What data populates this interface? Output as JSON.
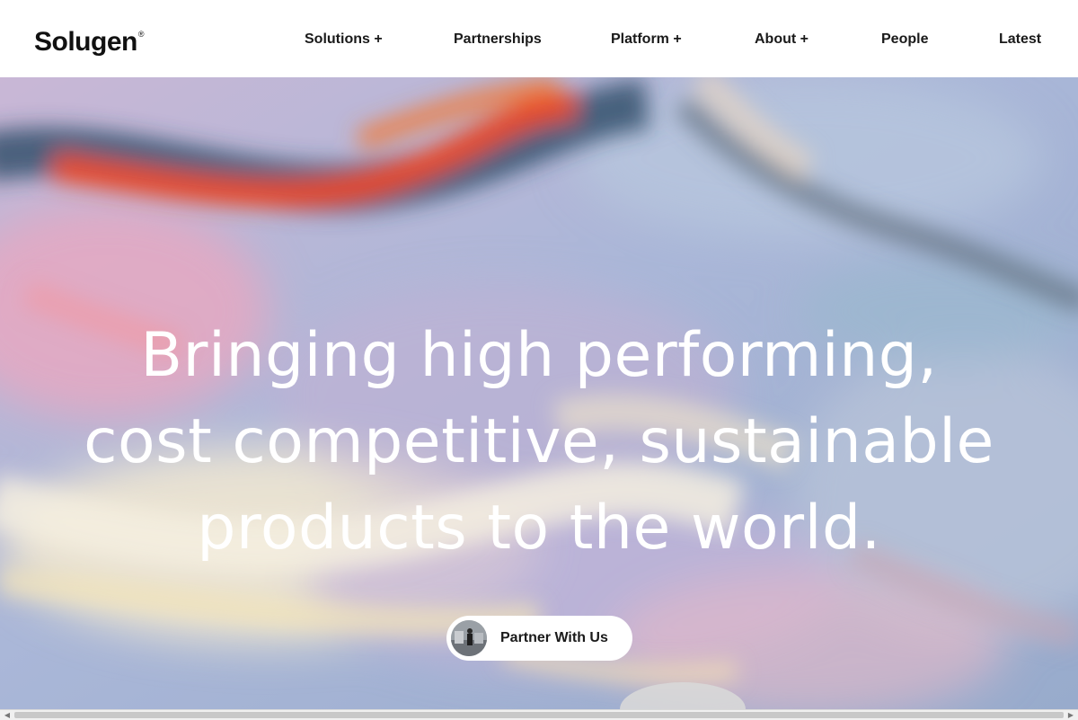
{
  "brand": {
    "name": "Solugen",
    "mark": "®"
  },
  "nav": {
    "items": [
      {
        "label": "Solutions +"
      },
      {
        "label": "Partnerships"
      },
      {
        "label": "Platform +"
      },
      {
        "label": "About +"
      },
      {
        "label": "People"
      },
      {
        "label": "Latest"
      }
    ]
  },
  "hero": {
    "headline_lines": [
      "Bringing high performing,",
      "cost competitive, sustainable",
      "products to the world."
    ],
    "cta_label": "Partner With Us"
  },
  "colors": {
    "header_bg": "#ffffff",
    "text": "#1a1a1a",
    "headline": "#ffffff",
    "cta_bg": "#ffffff"
  },
  "icons": {
    "scroll_left": "left-arrow-icon",
    "scroll_right": "right-arrow-icon"
  }
}
